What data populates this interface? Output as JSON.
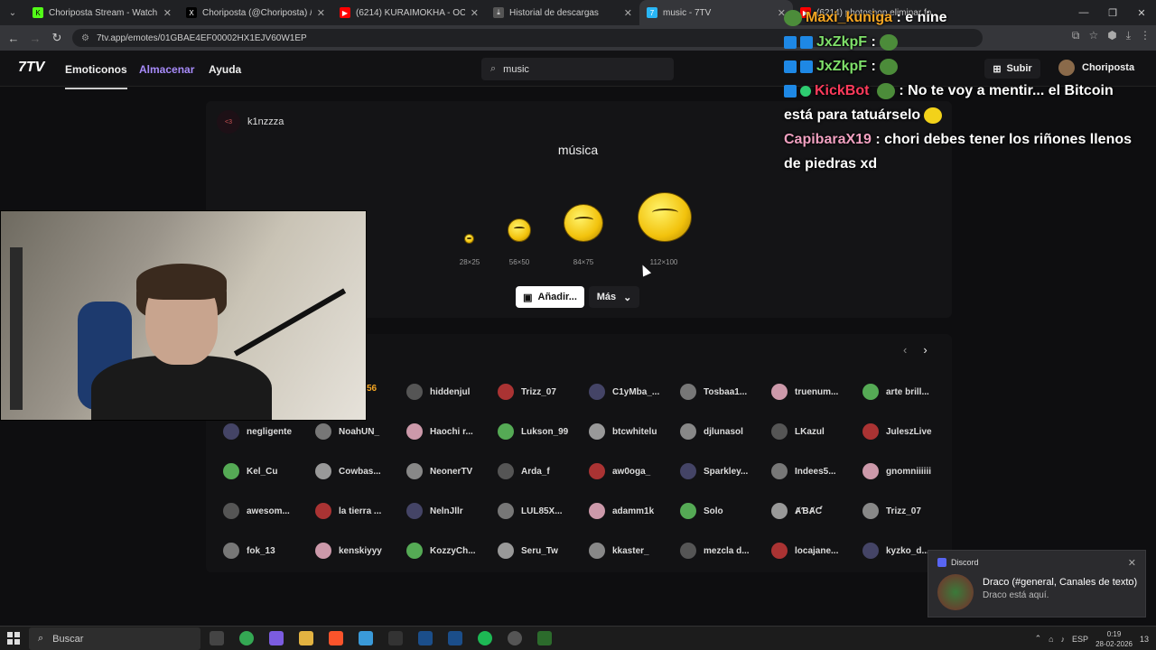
{
  "browser": {
    "tabs": [
      {
        "label": "Choriposta Stream - Watch Live",
        "favicon_color": "#53fc18",
        "favicon_glyph": "K"
      },
      {
        "label": "Choriposta (@Choriposta) / X",
        "favicon_color": "#000000",
        "favicon_glyph": "X"
      },
      {
        "label": "(6214) KURAIMOKHA - OC",
        "favicon_color": "#ff0000",
        "favicon_glyph": "▶"
      },
      {
        "label": "Historial de descargas",
        "favicon_color": "#555555",
        "favicon_glyph": "⤓"
      },
      {
        "label": "music - 7TV",
        "favicon_color": "#29b6f6",
        "favicon_glyph": "7"
      },
      {
        "label": "(6214) photoshop eliminar fo",
        "favicon_color": "#ff0000",
        "favicon_glyph": "▶"
      }
    ],
    "url": "7tv.app/emotes/01GBAE4EF00002HX1EJV60W1EP"
  },
  "site": {
    "nav": {
      "logo": "7TV",
      "emotes": "Emoticonos",
      "store": "Almacenar",
      "help": "Ayuda"
    },
    "search": {
      "value": "music"
    },
    "upload": "Subir",
    "profile": "Choriposta"
  },
  "emote": {
    "owner": "k1nzzza",
    "owner_badge": "<3",
    "name": "música",
    "sizes": [
      "28×25",
      "56×50",
      "84×75",
      "112×100"
    ],
    "add_button": "Añadir...",
    "more_button": "Más"
  },
  "users": [
    [
      "56",
      "hiddenjul",
      "Trizz_07",
      "C1yMba_...",
      "Tosbaa1...",
      "truenum...",
      "arte brill..."
    ],
    [
      "negligente",
      "NoahUN_",
      "Haochi r...",
      "Lukson_99",
      "btcwhitelu",
      "djlunasol",
      "LKazul",
      "JuleszLive"
    ],
    [
      "Kel_Cu",
      "Cowbas...",
      "NeonerTV",
      "Arda_f",
      "aw0oga_",
      "Sparkley...",
      "Indees5...",
      "gnomniiiiii"
    ],
    [
      "awesom...",
      "la tierra ...",
      "NelnJllr",
      "LUL85X...",
      "adamm1k",
      "Solo",
      "ȺƁȺƇ",
      "Trizz_07"
    ],
    [
      "fok_13",
      "kenskiyyy",
      "KozzyCh...",
      "Seru_Tw",
      "kkaster_",
      "mezcla d...",
      "locajane...",
      "kyzko_d..."
    ]
  ],
  "chat": [
    {
      "user": "Maxi_kuniga",
      "user_color": "#f5a623",
      "message": ": e nine"
    },
    {
      "user": "JxZkpF",
      "user_color": "#7fe06a",
      "message": ":"
    },
    {
      "user": "JxZkpF",
      "user_color": "#7fe06a",
      "message": ":"
    },
    {
      "user": "KickBot",
      "user_color": "#ff3b5c",
      "message": ": No te voy a mentir... el Bitcoin está para tatuárselo"
    },
    {
      "user": "CapibaraX19",
      "user_color": "#f0a0c0",
      "message": ": chori debes tener los riñones llenos de piedras xd"
    }
  ],
  "toast": {
    "app": "Discord",
    "title": "Draco (#general, Canales de texto)",
    "body": "Draco está aquí."
  },
  "taskbar": {
    "search": "Buscar",
    "lang": "ESP",
    "time": "0:19",
    "date": "28-02-2026",
    "notifications": "13"
  }
}
